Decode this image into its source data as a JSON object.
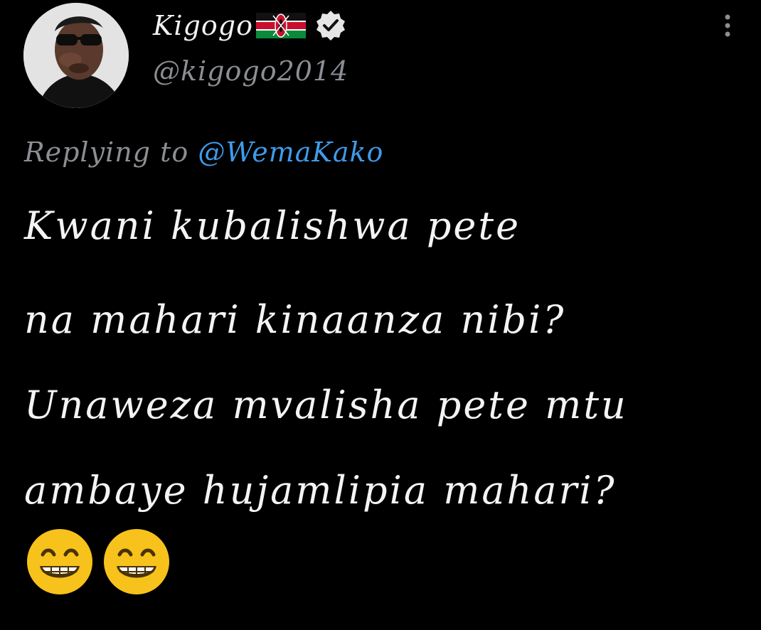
{
  "author": {
    "display_name": "Kigogo",
    "flag_icon": "kenya-flag-icon",
    "verified_icon": "verified-badge-icon",
    "handle": "@kigogo2014",
    "avatar_icon": "avatar-photo"
  },
  "menu": {
    "icon": "more-vertical-icon"
  },
  "reply": {
    "prefix": "Replying to",
    "mention": "@WemaKako"
  },
  "tweet": {
    "lines": [
      "Kwani kubalishwa pete",
      "na mahari kinaanza nibi?",
      "Unaweza mvalisha pete mtu",
      "ambaye hujamlipia mahari?"
    ],
    "emojis": [
      "grinning-face-icon",
      "grinning-face-icon"
    ]
  },
  "colors": {
    "background": "#000000",
    "text": "#f4f4f4",
    "muted": "#8b8e93",
    "link": "#3f9bea",
    "emoji": "#f7c21b"
  }
}
